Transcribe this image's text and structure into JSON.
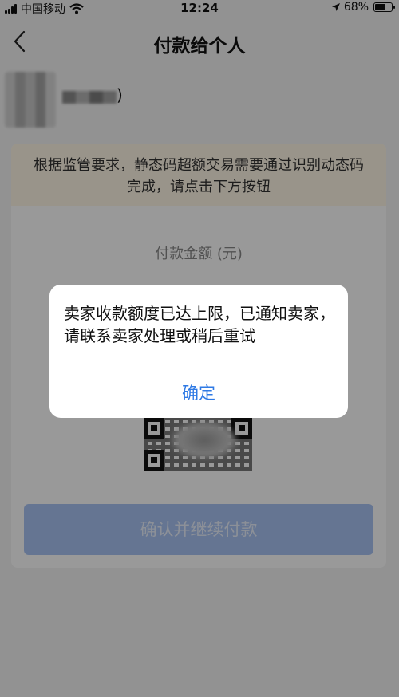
{
  "status_bar": {
    "carrier": "中国移动",
    "time": "12:24",
    "battery_percent": "68%",
    "battery_level": 0.68
  },
  "nav": {
    "title": "付款给个人",
    "back_icon": "chevron-left-icon"
  },
  "payee": {
    "name_suffix": ")"
  },
  "card": {
    "notice": "根据监管要求，静态码超额交易需要通过识别动态码完成，请点击下方按钮",
    "amount_label": "付款金额 (元)",
    "confirm_button": "确认并继续付款"
  },
  "alert": {
    "message": "卖家收款额度已达上限，已通知卖家，请联系卖家处理或稍后重试",
    "ok_button": "确定"
  },
  "colors": {
    "accent": "#2f7ae5",
    "button_disabled": "#a9c4f3",
    "notice_bg": "#fff7e6"
  }
}
